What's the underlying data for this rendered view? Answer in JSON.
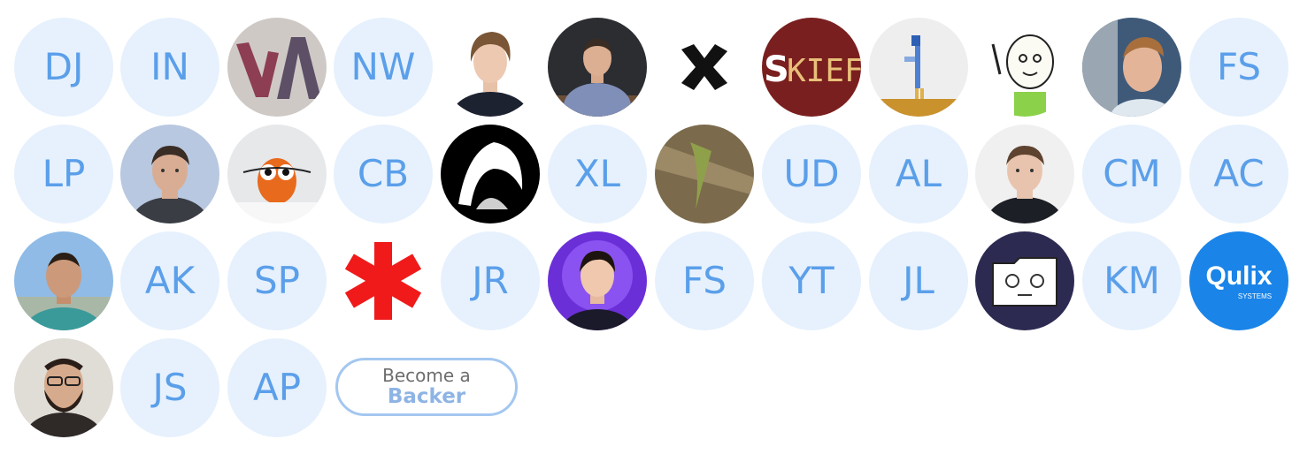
{
  "backers": [
    {
      "kind": "initials",
      "text": "DJ"
    },
    {
      "kind": "initials",
      "text": "IN"
    },
    {
      "kind": "photo",
      "icon": "va-logo-icon"
    },
    {
      "kind": "initials",
      "text": "NW"
    },
    {
      "kind": "photo",
      "icon": "young-man-avatar-icon"
    },
    {
      "kind": "photo",
      "icon": "man-at-desk-avatar-icon"
    },
    {
      "kind": "photo",
      "icon": "black-x-logo-icon"
    },
    {
      "kind": "photo",
      "icon": "skier-logo-icon"
    },
    {
      "kind": "photo",
      "icon": "pixel-bird-avatar-icon"
    },
    {
      "kind": "photo",
      "icon": "cartoon-waving-avatar-icon"
    },
    {
      "kind": "photo",
      "icon": "man-side-view-avatar-icon"
    },
    {
      "kind": "initials",
      "text": "FS"
    },
    {
      "kind": "initials",
      "text": "LP"
    },
    {
      "kind": "photo",
      "icon": "man-long-hair-avatar-icon"
    },
    {
      "kind": "photo",
      "icon": "orange-owl-avatar-icon"
    },
    {
      "kind": "initials",
      "text": "CB"
    },
    {
      "kind": "photo",
      "icon": "anime-character-avatar-icon"
    },
    {
      "kind": "initials",
      "text": "XL"
    },
    {
      "kind": "photo",
      "icon": "lizard-on-tree-avatar-icon"
    },
    {
      "kind": "initials",
      "text": "UD"
    },
    {
      "kind": "initials",
      "text": "AL"
    },
    {
      "kind": "photo",
      "icon": "young-man-portrait-avatar-icon"
    },
    {
      "kind": "initials",
      "text": "CM"
    },
    {
      "kind": "initials",
      "text": "AC"
    },
    {
      "kind": "photo",
      "icon": "man-outdoors-avatar-icon"
    },
    {
      "kind": "initials",
      "text": "AK"
    },
    {
      "kind": "initials",
      "text": "SP"
    },
    {
      "kind": "photo",
      "icon": "red-asterisk-logo-icon"
    },
    {
      "kind": "initials",
      "text": "JR"
    },
    {
      "kind": "photo",
      "icon": "man-purple-background-avatar-icon"
    },
    {
      "kind": "initials",
      "text": "FS"
    },
    {
      "kind": "initials",
      "text": "YT"
    },
    {
      "kind": "initials",
      "text": "JL"
    },
    {
      "kind": "photo",
      "icon": "dizzy-folder-logo-icon"
    },
    {
      "kind": "initials",
      "text": "KM"
    },
    {
      "kind": "logo",
      "icon": "qulix-logo-icon",
      "text": "Qulix",
      "subtext": "SYSTEMS"
    },
    {
      "kind": "photo",
      "icon": "bearded-man-avatar-icon"
    },
    {
      "kind": "initials",
      "text": "JS"
    },
    {
      "kind": "initials",
      "text": "AP"
    }
  ],
  "cta": {
    "line1": "Become a",
    "line2": "Backer"
  },
  "colors": {
    "initials_bg": "#e6f1fd",
    "initials_text": "#5b9fea",
    "cta_border": "#a4c7f0",
    "cta_accent": "#8eb4e4",
    "qulix_blue": "#1a84e8"
  }
}
